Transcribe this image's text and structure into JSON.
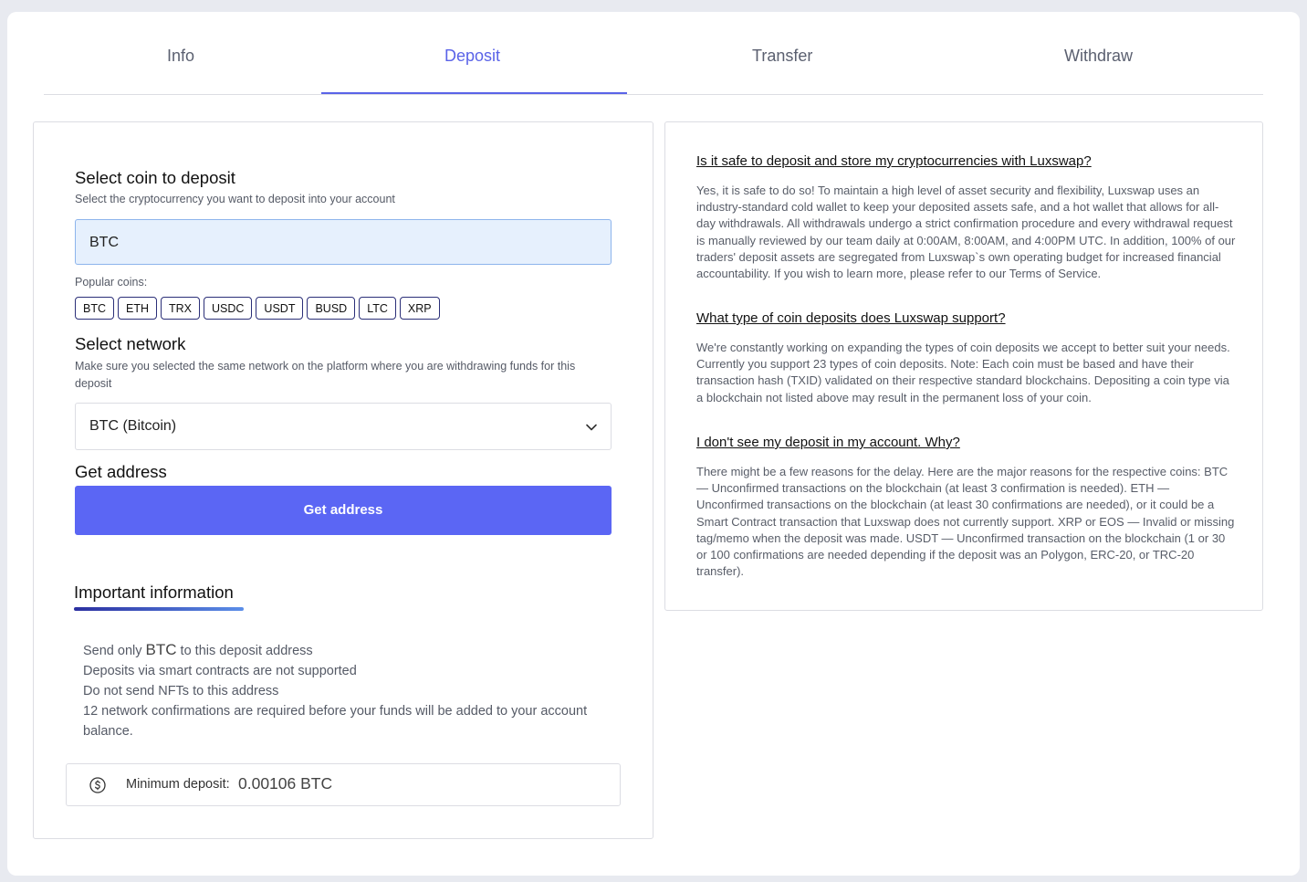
{
  "tabs": [
    {
      "label": "Info"
    },
    {
      "label": "Deposit"
    },
    {
      "label": "Transfer"
    },
    {
      "label": "Withdraw"
    }
  ],
  "active_tab": "Deposit",
  "deposit": {
    "select_coin": {
      "title": "Select coin to deposit",
      "subtitle": "Select the cryptocurrency you want to deposit into your account",
      "value": "BTC"
    },
    "popular_coins_label": "Popular coins:",
    "popular_coins": [
      "BTC",
      "ETH",
      "TRX",
      "USDC",
      "USDT",
      "BUSD",
      "LTC",
      "XRP"
    ],
    "select_network": {
      "title": "Select network",
      "subtitle": "Make sure you selected the same network on the platform where you are withdrawing funds for this deposit",
      "value": "BTC (Bitcoin)"
    },
    "get_address": {
      "title": "Get address",
      "button_label": "Get address"
    },
    "important": {
      "title": "Important information",
      "line1_prefix": "Send only ",
      "line1_coin": "BTC",
      "line1_suffix": " to this deposit address",
      "line2": "Deposits via smart contracts are not supported",
      "line3": "Do not send NFTs to this address",
      "line4": "12 network confirmations are required before your funds will be added to your account balance."
    },
    "minimum": {
      "label": "Minimum deposit:",
      "value": "0.00106 BTC"
    }
  },
  "faq": [
    {
      "question": "Is it safe to deposit and store my cryptocurrencies with Luxswap?",
      "answer": "Yes, it is safe to do so! To maintain a high level of asset security and flexibility, Luxswap uses an industry-standard cold wallet to keep your deposited assets safe, and a hot wallet that allows for all-day withdrawals. All withdrawals undergo a strict confirmation procedure and every withdrawal request is manually reviewed by our team daily at 0:00AM, 8:00AM, and 4:00PM UTC. In addition, 100% of our traders' deposit assets are segregated from Luxswap`s own operating budget for increased financial accountability. If you wish to learn more, please refer to our Terms of Service."
    },
    {
      "question": "What type of coin deposits does Luxswap support?",
      "answer": "We're constantly working on expanding the types of coin deposits we accept to better suit your needs. Currently you support 23 types of coin deposits. Note: Each coin must be based and have their transaction hash (TXID) validated on their respective standard blockchains. Depositing a coin type via a blockchain not listed above may result in the permanent loss of your coin."
    },
    {
      "question": "I don't see my deposit in my account. Why?",
      "answer": "There might be a few reasons for the delay. Here are the major reasons for the respective coins: BTC — Unconfirmed transactions on the blockchain (at least 3 confirmation is needed). ETH — Unconfirmed transactions on the blockchain (at least 30 confirmations are needed), or it could be a Smart Contract transaction that Luxswap does not currently support. XRP or EOS — Invalid or missing tag/memo when the deposit was made. USDT — Unconfirmed transaction on the blockchain (1 or 30 or 100 confirmations are needed depending if the deposit was an Polygon, ERC-20, or TRC-20 transfer)."
    }
  ],
  "colors": {
    "accent": "#5a63e8",
    "button": "#5b66f4",
    "input_bg": "#e6f0fd"
  },
  "icons": {
    "network_dropdown": "chevron-down-icon",
    "minimum_deposit": "dollar-circle-icon"
  }
}
